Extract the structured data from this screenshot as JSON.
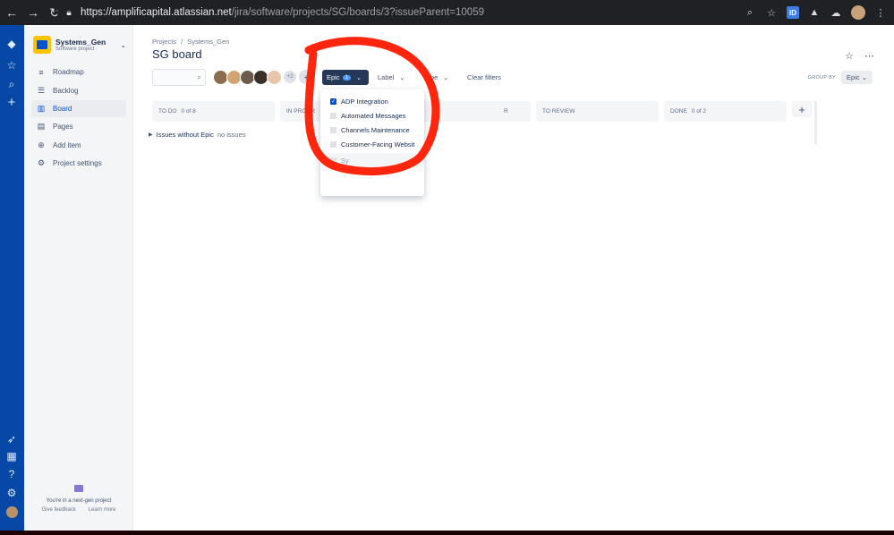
{
  "browser": {
    "url_host": "https://amplificapital.atlassian.net",
    "url_path": "/jira/software/projects/SG/boards/3?issueParent=10059",
    "ext_label": "ID"
  },
  "project": {
    "name": "Systems_Gen",
    "type": "Software project"
  },
  "project_nav": {
    "items": [
      {
        "label": "Roadmap",
        "icon": "roadmap-icon"
      },
      {
        "label": "Backlog",
        "icon": "backlog-icon"
      },
      {
        "label": "Board",
        "icon": "board-icon"
      },
      {
        "label": "Pages",
        "icon": "pages-icon"
      },
      {
        "label": "Add item",
        "icon": "add-icon"
      },
      {
        "label": "Project settings",
        "icon": "gear-icon"
      }
    ],
    "active": "Board"
  },
  "nextgen": {
    "text": "You're in a next-gen project",
    "feedback": "Give feedback",
    "learn_more": "Learn more"
  },
  "breadcrumb": {
    "projects": "Projects",
    "separator": "/",
    "project": "Systems_Gen"
  },
  "page_title": "SG board",
  "filters": {
    "epic_label": "Epic",
    "epic_count": "1",
    "label_label": "Label",
    "type_label": "Type",
    "clear": "Clear filters",
    "more_people": "+2"
  },
  "group_by": {
    "label": "GROUP BY",
    "value": "Epic"
  },
  "columns": [
    {
      "name": "TO DO",
      "count": "0 of 8"
    },
    {
      "name": "IN PROGR",
      "count": ""
    },
    {
      "name": "R",
      "count": ""
    },
    {
      "name": "TO REVIEW",
      "count": ""
    },
    {
      "name": "DONE",
      "count": "0 of 2"
    }
  ],
  "swimlane": {
    "label": "Issues without Epic",
    "status": "no issues"
  },
  "epic_dropdown": {
    "items": [
      {
        "label": "ADP Integration",
        "checked": true
      },
      {
        "label": "Automated Messages",
        "checked": false
      },
      {
        "label": "Channels Maintenance",
        "checked": false
      },
      {
        "label": "Customer-Facing Websit",
        "checked": false
      },
      {
        "label": "Sy",
        "checked": false
      }
    ]
  },
  "colors": {
    "global_nav": "#0747a6",
    "accent": "#0052cc",
    "annotation": "#ff1a00"
  }
}
